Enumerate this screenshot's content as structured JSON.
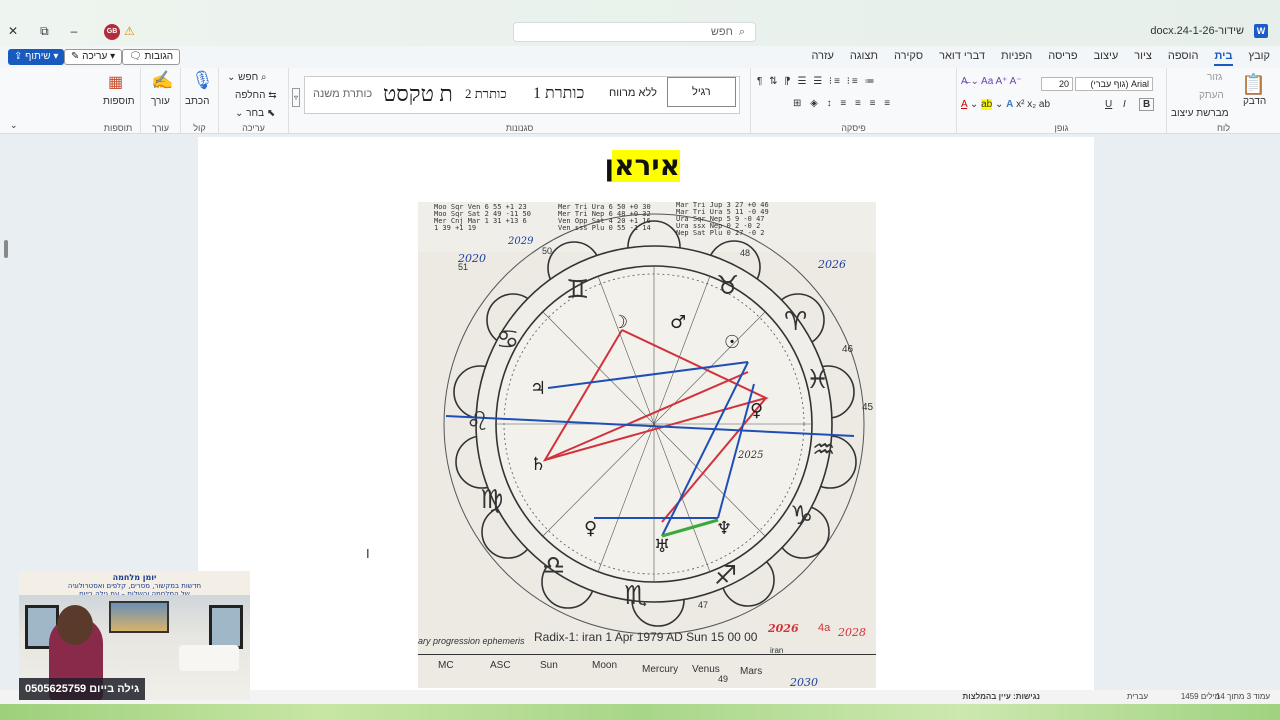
{
  "titlebar": {
    "doc_title": "שידור-docx.24-1-26",
    "search_placeholder": "חפש",
    "avatar_initials": "GB",
    "close": "✕",
    "restore": "⧉",
    "minimize": "–"
  },
  "menu": {
    "tabs": [
      "קובץ",
      "בית",
      "הוספה",
      "ציור",
      "עיצוב",
      "פריסה",
      "הפניות",
      "דברי דואר",
      "סקירה",
      "תצוגה",
      "עזרה"
    ],
    "active_tab": "בית",
    "share": "שיתוף",
    "editing": "עריכה",
    "comments": "הגובות"
  },
  "ribbon": {
    "clipboard": {
      "label": "לוח",
      "paste": "הדבק",
      "cut": "גזור",
      "copy": "העתק",
      "format_painter": "מברשת עיצוב"
    },
    "font": {
      "label": "גופן",
      "font_name": "Arial (גוף עברי)",
      "font_size": "20",
      "bold": "B",
      "italic": "I",
      "underline": "U"
    },
    "paragraph": {
      "label": "פיסקה"
    },
    "styles": {
      "label": "סגנונות",
      "items": [
        "רגיל",
        "ללא מרווח",
        "כותרת 1",
        "כותרת 2",
        "ת טקסט",
        "כותרת משנה"
      ]
    },
    "editing": {
      "label": "עריכה",
      "find": "חפש",
      "replace": "החלפה",
      "select": "בחר"
    },
    "voice": {
      "label": "קול",
      "dictate": "הכתב"
    },
    "editor": {
      "label": "עורך",
      "editor": "עורך"
    },
    "addins": {
      "label": "תוספות",
      "addins": "תוספות"
    }
  },
  "document": {
    "heading": "איראן",
    "chart_caption": "Radix-1: iran  1 Apr 1979 AD Sun 15 00 00",
    "chart_sub": "iran",
    "handwritten_years": [
      "2020",
      "2029",
      "2026",
      "2025",
      "2026",
      "2028",
      "2030"
    ],
    "handwritten_marks": [
      "47",
      "46",
      "45",
      "48",
      "51",
      "50",
      "49",
      "4a"
    ],
    "footer_left": "ary progression ephemeris",
    "footer_cols": [
      "MC",
      "ASC",
      "Sun",
      "Moon",
      "Mercury",
      "Venus",
      "Mars"
    ],
    "aspects_left": [
      "Moo Sqr Ven  6 55 +1 23",
      "Moo Sqr Sat  2 49 -11 50",
      "Mer Cnj Mar  1 31 +13 6",
      "          1 39 +1 19"
    ],
    "aspects_mid": [
      "Mer Tri Ura  6 50 +0 30",
      "Mer Tri Nep  6 48 +0 32",
      "Ven Opp Sat  4 20 +1 16",
      "Ven sss Plu  0 55 -1 14"
    ],
    "aspects_right": [
      "Mar Tri Jup  3 27 +0 46",
      "Mar Tri Ura  5 11 -0 49",
      "Ura Sqr Nep  5 9  -0 47",
      "Ura ssx Nep  0 2  -0 2",
      "Nep Sat Plu  0 27 -0 2"
    ]
  },
  "statusbar": {
    "page": "עמוד 3 מתוך 14",
    "words": "1459 מילים",
    "language": "עברית",
    "accessibility": "נגישות: עיין בהמלצות"
  },
  "webcam": {
    "banner_title": "יומן מלחמה",
    "banner_line2": "חדשות במקשור, מסרים, קלפים ואסטרולוגיה",
    "banner_line3": "של המלחמה והשלום – עם גילה בייום",
    "name": "גילה בייום 0505625759"
  },
  "colors": {
    "accent": "#185abd",
    "highlight": "#ffff00",
    "red_line": "#d2323c",
    "blue_line": "#1f4fb6",
    "green_line": "#3aa83a"
  }
}
